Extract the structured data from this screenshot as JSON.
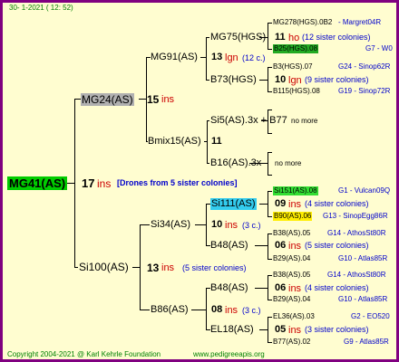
{
  "header": {
    "date": "30-   1-2021  ( 12: 52)"
  },
  "footer": {
    "copyright": "Copyright 2004-2021 @ Karl Kehrle Foundation",
    "website": "www.pedigreeapis.org"
  },
  "root": {
    "name": "MG41(AS)",
    "num": "17",
    "ins": "ins",
    "note": "[Drones from 5 sister colonies]"
  },
  "gen1": {
    "mg24": {
      "name": "MG24(AS)",
      "num": "15",
      "ins": "ins"
    },
    "si100": {
      "name": "Si100(AS)",
      "num": "13",
      "ins": "ins",
      "note": "(5 sister colonies)"
    }
  },
  "gen2": {
    "mg91": {
      "name": "MG91(AS)",
      "num": "13",
      "ins": "lgn",
      "note": "(12 c.)"
    },
    "bmix15": {
      "name": "Bmix15(AS)",
      "num": "11"
    },
    "si34": {
      "name": "Si34(AS)",
      "num": "10",
      "ins": "ins",
      "note": "(3 c.)"
    },
    "b86": {
      "name": "B86(AS)",
      "num": "08",
      "ins": "ins",
      "note": "(3 c.)"
    }
  },
  "gen3": {
    "mg75": {
      "name": "MG75(HGS)",
      "num": "11",
      "ins": "ho",
      "note": "(12 sister colonies)"
    },
    "b73": {
      "name": "B73(HGS)",
      "num": "10",
      "ins": "lgn",
      "note": "(9 sister colonies)"
    },
    "si5": {
      "name": "Si5(AS).3x + B77",
      "more": "no more"
    },
    "b16": {
      "name": "B16(AS).3x",
      "more": "no more"
    },
    "si111": {
      "name": "Si111(AS)",
      "num": "09",
      "ins": "ins",
      "note": "(4 sister colonies)"
    },
    "b48a": {
      "name": "B48(AS)",
      "num": "06",
      "ins": "ins",
      "note": "(5 sister colonies)"
    },
    "b48b": {
      "name": "B48(AS)",
      "num": "06",
      "ins": "ins",
      "note": "(4 sister colonies)"
    },
    "el18": {
      "name": "EL18(AS)",
      "num": "05",
      "ins": "ins",
      "note": "(3 sister colonies)"
    }
  },
  "gen4": {
    "mg278": {
      "name": "MG278(HGS).0B2",
      "right": "- Margret04R"
    },
    "b25": {
      "name": "B25(HGS).08",
      "right": "G7 - W0"
    },
    "b3": {
      "name": "B3(HGS).07",
      "right": "G24 - Sinop62R"
    },
    "b115": {
      "name": "B115(HGS).08",
      "right": "G19 - Sinop72R"
    },
    "si151": {
      "name": "Si151(AS).08",
      "right": "G1 - Vulcan09Q"
    },
    "b90": {
      "name": "B90(AS).06",
      "right": "G13 - SinopEgg86R"
    },
    "b38a": {
      "name": "B38(AS).05",
      "right": "G14 - AthosSt80R"
    },
    "b29a": {
      "name": "B29(AS).04",
      "right": "G10 - Atlas85R"
    },
    "b38b": {
      "name": "B38(AS).05",
      "right": "G14 - AthosSt80R"
    },
    "b29b": {
      "name": "B29(AS).04",
      "right": "G10 - Atlas85R"
    },
    "el36": {
      "name": "EL36(AS).03",
      "right": "G2 - EO520"
    },
    "b77": {
      "name": "B77(AS).02",
      "right": "G9 - Atlas85R"
    }
  }
}
